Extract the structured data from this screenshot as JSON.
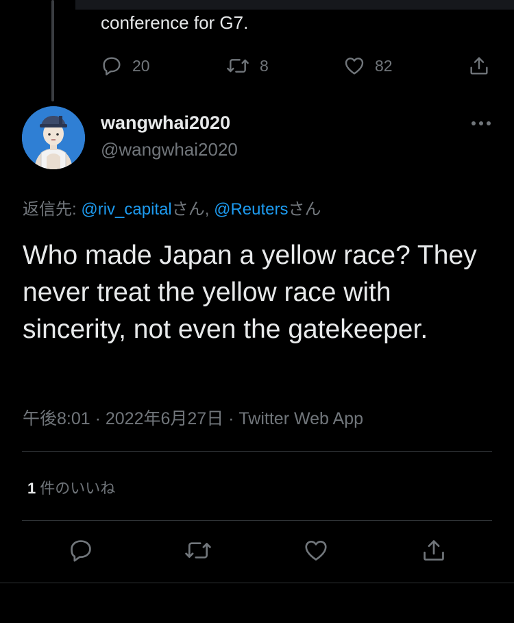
{
  "previous_tweet": {
    "text": "conference for G7.",
    "actions": {
      "reply_count": "20",
      "retweet_count": "8",
      "like_count": "82"
    }
  },
  "tweet": {
    "author": {
      "display_name": "wangwhai2020",
      "handle": "@wangwhai2020"
    },
    "reply_to": {
      "prefix": "返信先: ",
      "mention_1": "@riv_capital",
      "suffix_1": "さん, ",
      "mention_2": "@Reuters",
      "suffix_2": "さん"
    },
    "text": "Who made Japan a yellow race? They never treat the yellow race with sincerity, not even the gatekeeper.",
    "meta": "午後8:01 · 2022年6月27日 · Twitter Web App",
    "likes": {
      "count": "1",
      "label": "件のいいね"
    }
  },
  "colors": {
    "background": "#000000",
    "text": "#e7e9ea",
    "muted": "#71767b",
    "link": "#1d9bf0",
    "divider": "#2f3336"
  },
  "icons": [
    "reply-icon",
    "retweet-icon",
    "like-icon",
    "share-icon",
    "more-icon"
  ]
}
